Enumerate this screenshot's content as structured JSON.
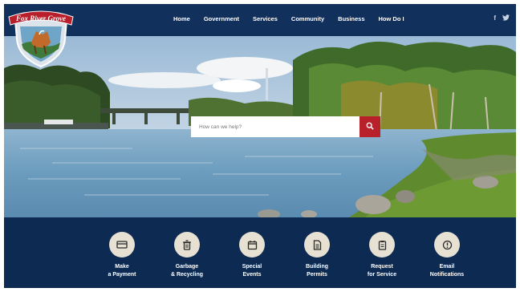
{
  "logo": {
    "text": "Fox River Grove"
  },
  "nav": [
    {
      "label": "Home"
    },
    {
      "label": "Government"
    },
    {
      "label": "Services"
    },
    {
      "label": "Community"
    },
    {
      "label": "Business"
    },
    {
      "label": "How Do I"
    }
  ],
  "social": {
    "facebook": "f",
    "twitter": "t"
  },
  "search": {
    "placeholder": "How can we help?",
    "icon": "search-icon"
  },
  "quick_links": [
    {
      "line1": "Make",
      "line2": "a Payment",
      "icon": "credit-card-icon"
    },
    {
      "line1": "Garbage",
      "line2": "& Recycling",
      "icon": "trash-icon"
    },
    {
      "line1": "Special",
      "line2": "Events",
      "icon": "calendar-icon"
    },
    {
      "line1": "Building",
      "line2": "Permits",
      "icon": "document-icon"
    },
    {
      "line1": "Request",
      "line2": "for Service",
      "icon": "clipboard-icon"
    },
    {
      "line1": "Email",
      "line2": "Notifications",
      "icon": "alert-icon"
    }
  ],
  "colors": {
    "navy": "#11305c",
    "accent_red": "#b8202a",
    "icon_circle": "#e6e1d2"
  }
}
